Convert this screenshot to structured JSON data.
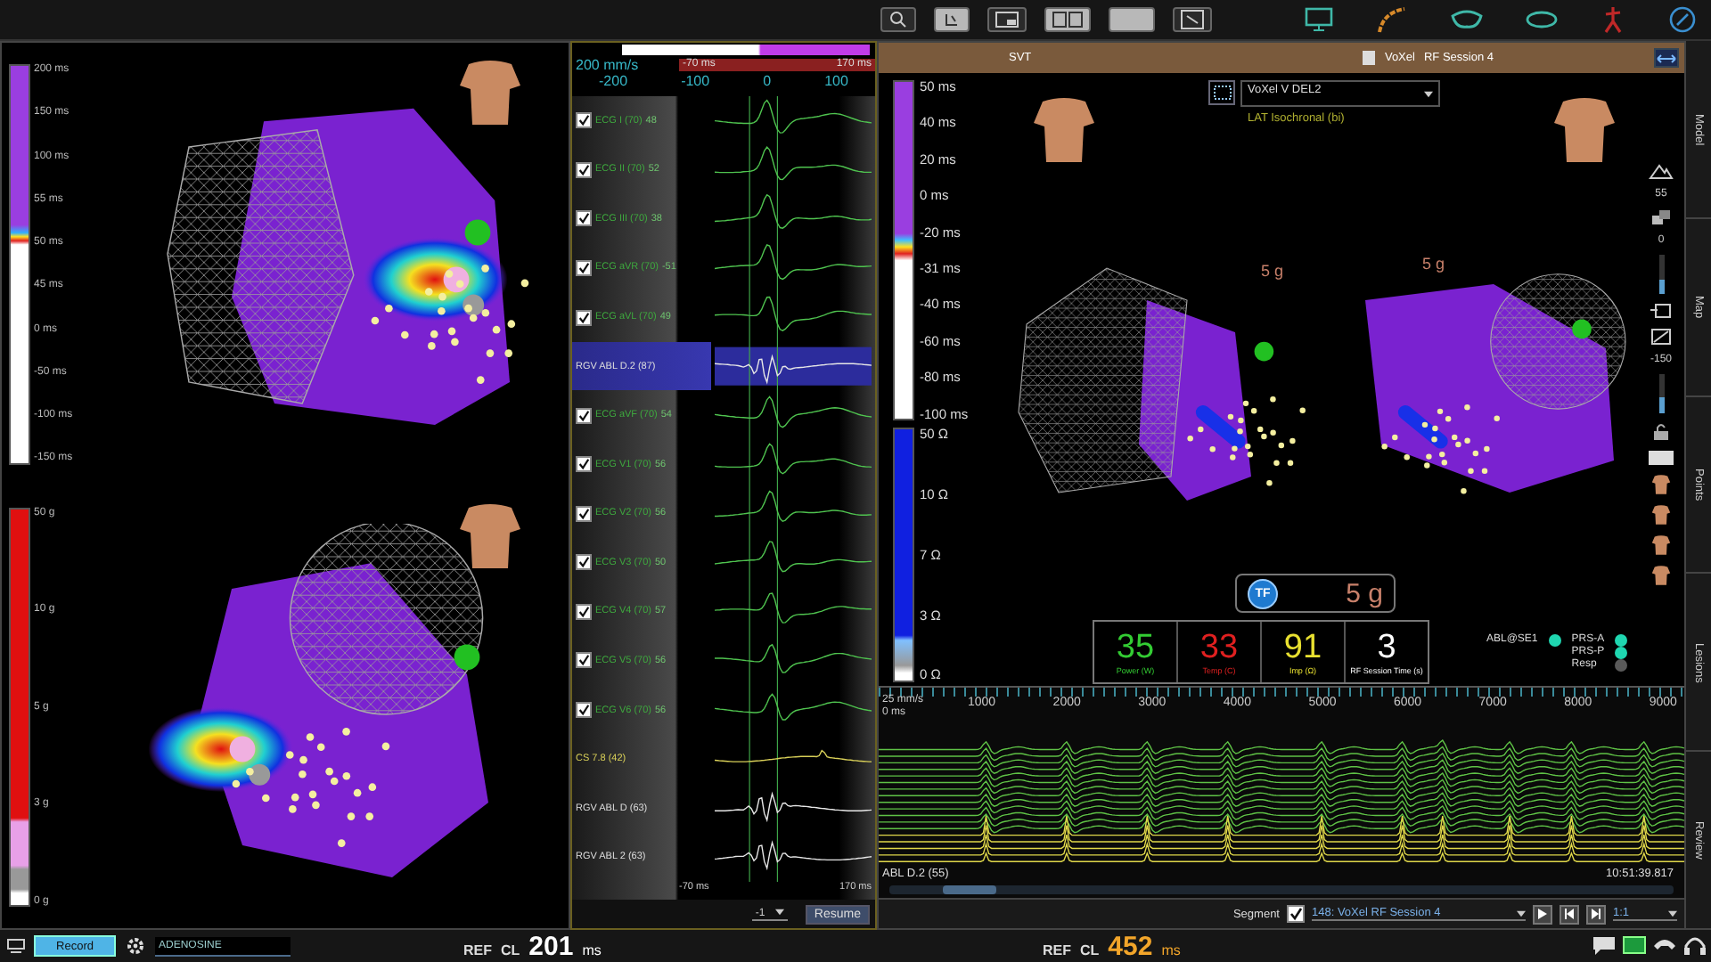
{
  "left_panel": {
    "sections": [
      {
        "scale_labels": [
          "200 ms",
          "150 ms",
          "100 ms",
          "55 ms",
          "50 ms",
          "45 ms",
          "0 ms",
          "-50 ms",
          "-100 ms",
          "-150 ms"
        ]
      },
      {
        "scale_labels": [
          "50 g",
          "10 g",
          "5 g",
          "3 g",
          "0 g"
        ]
      }
    ]
  },
  "ecg": {
    "speed": "200 mm/s",
    "window_start": "-70 ms",
    "window_end": "170 ms",
    "ticks": [
      "-200",
      "-100",
      "0",
      "100"
    ],
    "channels": [
      {
        "kind": "ecg",
        "label": "ECG I (70)",
        "value": "48",
        "checked": true,
        "selected": false
      },
      {
        "kind": "ecg",
        "label": "ECG II (70)",
        "value": "52",
        "checked": true,
        "selected": false
      },
      {
        "kind": "ecg",
        "label": "ECG III (70)",
        "value": "38",
        "checked": true,
        "selected": false
      },
      {
        "kind": "ecg",
        "label": "ECG aVR (70)",
        "value": "-51",
        "checked": true,
        "selected": false
      },
      {
        "kind": "ecg",
        "label": "ECG aVL (70)",
        "value": "49",
        "checked": true,
        "selected": false
      },
      {
        "kind": "abl",
        "label": "RGV ABL D.2 (87)",
        "selected": true
      },
      {
        "kind": "ecg",
        "label": "ECG aVF (70)",
        "value": "54",
        "checked": true,
        "selected": false
      },
      {
        "kind": "ecg",
        "label": "ECG V1 (70)",
        "value": "56",
        "checked": true,
        "selected": false
      },
      {
        "kind": "ecg",
        "label": "ECG V2 (70)",
        "value": "56",
        "checked": true,
        "selected": false
      },
      {
        "kind": "ecg",
        "label": "ECG V3 (70)",
        "value": "50",
        "checked": true,
        "selected": false
      },
      {
        "kind": "ecg",
        "label": "ECG V4 (70)",
        "value": "57",
        "checked": true,
        "selected": false
      },
      {
        "kind": "ecg",
        "label": "ECG V5 (70)",
        "value": "56",
        "checked": true,
        "selected": false
      },
      {
        "kind": "ecg",
        "label": "ECG V6 (70)",
        "value": "56",
        "checked": true,
        "selected": false
      },
      {
        "kind": "cs",
        "label": "CS 7.8 (42)",
        "selected": false
      },
      {
        "kind": "abl",
        "label": "RGV ABL D (63)",
        "selected": false
      },
      {
        "kind": "abl",
        "label": "RGV ABL 2 (63)",
        "selected": false
      }
    ],
    "footer_start": "-70 ms",
    "footer_end": "170 ms",
    "gain": "-1",
    "resume": "Resume"
  },
  "right_panel": {
    "rhythm": "SVT",
    "map_name": "VoXel",
    "session": "RF Session 4",
    "map_select": "VoXel V DEL2",
    "map_type": "LAT Isochronal (bi)",
    "lat_scale": [
      "50 ms",
      "40 ms",
      "20 ms",
      "0 ms",
      "-20 ms",
      "-31 ms",
      "-40 ms",
      "-60 ms",
      "-80 ms",
      "-100 ms"
    ],
    "impedance_scale": [
      "50 Ω",
      "10 Ω",
      "7 Ω",
      "3 Ω",
      "0 Ω"
    ],
    "maps": [
      {
        "force": "5 g"
      },
      {
        "force": "5 g"
      }
    ],
    "opacity": "55",
    "sliders": [
      {
        "value": "0",
        "level": 0.35
      },
      {
        "value": "-150",
        "level": 0.4
      }
    ],
    "tf_badge": {
      "icon": "TF",
      "force": "5 g"
    },
    "metrics": [
      {
        "value": "35",
        "label": "Power (W)",
        "color": "#33cc33"
      },
      {
        "value": "33",
        "label": "Temp (C)",
        "color": "#e02020"
      },
      {
        "value": "91",
        "label": "Imp (Ω)",
        "color": "#e8e030"
      },
      {
        "value": "3",
        "label": "RF Session Time (s)",
        "color": "#ffffff"
      }
    ],
    "status": [
      {
        "label": "ABL@SE1",
        "color": "#1fd6b0"
      },
      {
        "label": "PRS-A",
        "color": "#1fd6b0"
      },
      {
        "label": "PRS-P",
        "color": "#1fd6b0"
      },
      {
        "label": "Resp",
        "color": "#5a5a5a"
      }
    ],
    "waveform": {
      "speed": "25 mm/s",
      "start": "0 ms",
      "ticks": [
        "1000",
        "2000",
        "3000",
        "4000",
        "5000",
        "6000",
        "7000",
        "8000",
        "9000"
      ],
      "channel_label": "ABL D.2 (55)",
      "timestamp": "10:51:39.817"
    },
    "segment": {
      "label": "Segment",
      "checked": true,
      "value": "148: VoXel RF Session 4",
      "zoom": "1:1"
    }
  },
  "side_tabs": [
    {
      "label": "Model",
      "selected": false
    },
    {
      "label": "Map",
      "selected": false
    },
    {
      "label": "Points",
      "selected": false
    },
    {
      "label": "Lesions",
      "selected": false
    },
    {
      "label": "Review",
      "selected": false
    }
  ],
  "bottom_bar": {
    "record": "Record",
    "protocol": "ADENOSINE",
    "readouts": [
      {
        "ref": "REF",
        "cl": "CL",
        "value": "201",
        "unit": "ms",
        "color": "#ffffff"
      },
      {
        "ref": "REF",
        "cl": "CL",
        "value": "452",
        "unit": "ms",
        "color": "#f2a52a"
      }
    ]
  }
}
